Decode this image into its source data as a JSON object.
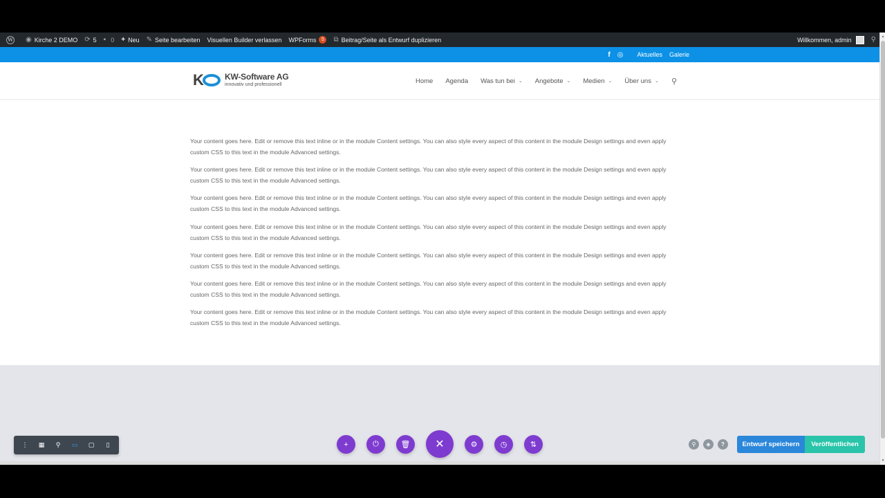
{
  "adminbar": {
    "site_name": "Kirche 2 DEMO",
    "updates_count": "5",
    "comments_count": "0",
    "new_label": "Neu",
    "edit_page_label": "Seite bearbeiten",
    "exit_builder_label": "Visuellen Builder verlassen",
    "wpforms_label": "WPForms",
    "wpforms_badge": "5",
    "duplicate_label": "Beitrag/Seite als Entwurf duplizieren",
    "welcome_label": "Willkommen, admin"
  },
  "topbar": {
    "facebook_glyph": "f",
    "links": [
      "Aktuelles",
      "Galerie"
    ]
  },
  "header": {
    "logo": {
      "mark_letter": "K",
      "name": "KW-Software AG",
      "tagline": "innovativ und professionell"
    },
    "nav": [
      {
        "label": "Home",
        "has_dropdown": false
      },
      {
        "label": "Agenda",
        "has_dropdown": false
      },
      {
        "label": "Was tun bei",
        "has_dropdown": true
      },
      {
        "label": "Angebote",
        "has_dropdown": true
      },
      {
        "label": "Medien",
        "has_dropdown": true
      },
      {
        "label": "Über uns",
        "has_dropdown": true
      }
    ]
  },
  "content": {
    "paragraphs": [
      "Your content goes here. Edit or remove this text inline or in the module Content settings. You can also style every aspect of this content in the module Design settings and even apply custom CSS to this text in the module Advanced settings.",
      "Your content goes here. Edit or remove this text inline or in the module Content settings. You can also style every aspect of this content in the module Design settings and even apply custom CSS to this text in the module Advanced settings.",
      "Your content goes here. Edit or remove this text inline or in the module Content settings. You can also style every aspect of this content in the module Design settings and even apply custom CSS to this text in the module Advanced settings.",
      "Your content goes here. Edit or remove this text inline or in the module Content settings. You can also style every aspect of this content in the module Design settings and even apply custom CSS to this text in the module Advanced settings.",
      "Your content goes here. Edit or remove this text inline or in the module Content settings. You can also style every aspect of this content in the module Design settings and even apply custom CSS to this text in the module Advanced settings.",
      "Your content goes here. Edit or remove this text inline or in the module Content settings. You can also style every aspect of this content in the module Design settings and even apply custom CSS to this text in the module Advanced settings.",
      "Your content goes here. Edit or remove this text inline or in the module Content settings. You can also style every aspect of this content in the module Design settings and even apply custom CSS to this text in the module Advanced settings."
    ]
  },
  "builder": {
    "left_toolbar_icons": [
      "more-vertical-icon",
      "wireframe-icon",
      "zoom-icon",
      "desktop-icon",
      "tablet-icon",
      "phone-icon"
    ],
    "center_icons": [
      "add-icon",
      "power-icon",
      "trash-icon",
      "close-icon",
      "settings-icon",
      "history-icon",
      "portability-icon"
    ],
    "right_icons": [
      "search-icon",
      "layers-icon",
      "help-icon"
    ],
    "help_glyph": "?",
    "save_draft_label": "Entwurf speichern",
    "publish_label": "Veröffentlichen"
  },
  "colors": {
    "adminbar": "#23282d",
    "topbar": "#0c91e6",
    "purple": "#7e3bd0",
    "save": "#2b87da",
    "publish": "#29c4a9"
  }
}
